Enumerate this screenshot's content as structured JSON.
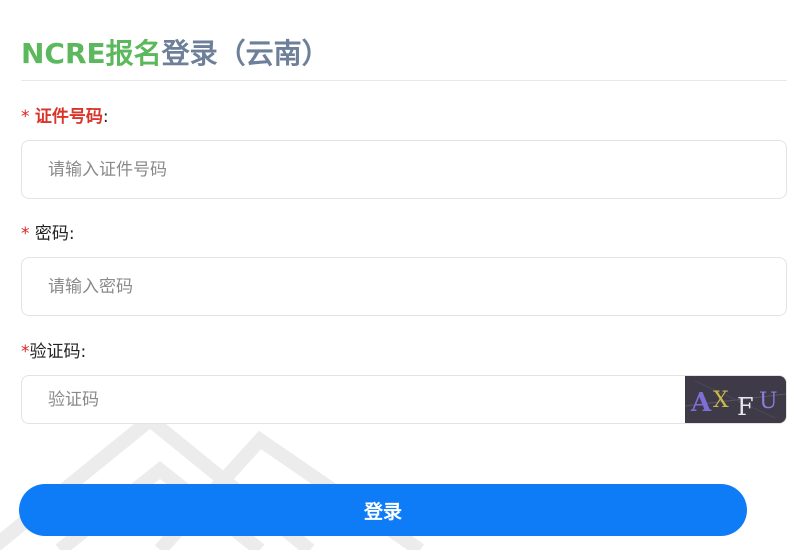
{
  "title": {
    "part1": "NCRE报名",
    "part2": "登录（云南）"
  },
  "fields": {
    "id_number": {
      "required_mark": "*",
      "label": "证件号码",
      "colon": ":",
      "placeholder": "请输入证件号码",
      "value": ""
    },
    "password": {
      "required_mark": "*",
      "label": "密码",
      "colon": ":",
      "placeholder": "请输入密码",
      "value": ""
    },
    "captcha": {
      "required_mark": "*",
      "label": "验证码",
      "colon": ":",
      "placeholder": "验证码",
      "value": "",
      "image_text": [
        "A",
        "X",
        "F",
        "U"
      ]
    }
  },
  "login_button": {
    "label": "登录"
  },
  "colors": {
    "title_green": "#5cb85c",
    "title_gray": "#6e7f99",
    "required_red": "#e02424",
    "button_blue": "#0f7cf7"
  }
}
